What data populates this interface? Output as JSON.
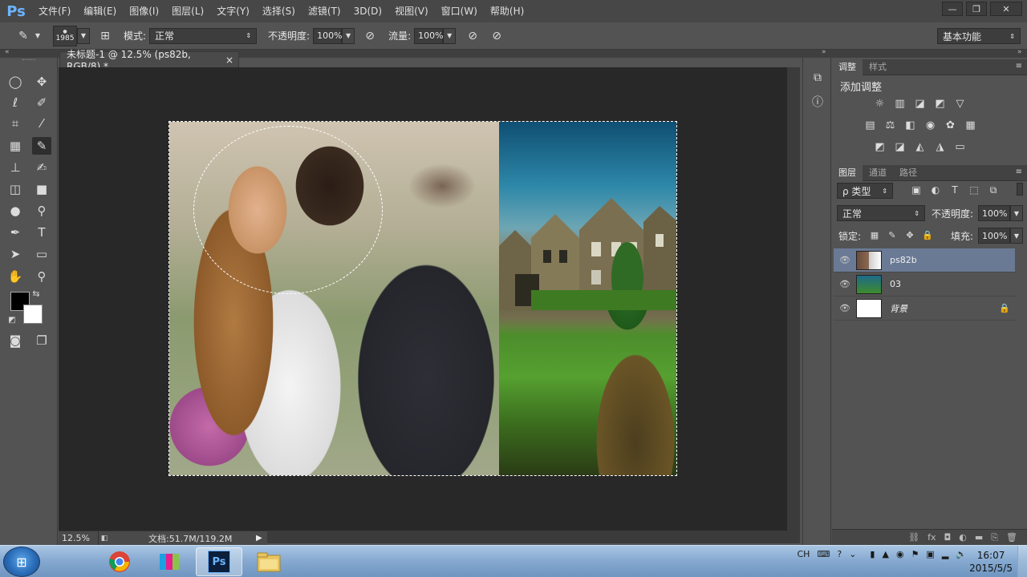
{
  "app": {
    "logo": "Ps"
  },
  "menu": [
    "文件(F)",
    "编辑(E)",
    "图像(I)",
    "图层(L)",
    "文字(Y)",
    "选择(S)",
    "滤镜(T)",
    "3D(D)",
    "视图(V)",
    "窗口(W)",
    "帮助(H)"
  ],
  "window_controls": {
    "minimize": "—",
    "restore": "❐",
    "close": "✕"
  },
  "options": {
    "brush_size": "1985",
    "mode_label": "模式:",
    "mode_value": "正常",
    "opacity_label": "不透明度:",
    "opacity_value": "100%",
    "flow_label": "流量:",
    "flow_value": "100%",
    "workspace": "基本功能"
  },
  "document": {
    "tab_title": "未标题-1 @ 12.5% (ps82b, RGB/8) *",
    "tab_close": "×"
  },
  "status": {
    "zoom": "12.5%",
    "doc_info": "文档:51.7M/119.2M"
  },
  "panels": {
    "adjust_tabs": [
      "调整",
      "样式"
    ],
    "adjust_title": "添加调整",
    "layers_tabs": [
      "图层",
      "通道",
      "路径"
    ],
    "kind_filter": "ρ 类型",
    "blend_mode": "正常",
    "opacity_label": "不透明度:",
    "opacity_value": "100%",
    "lock_label": "锁定:",
    "fill_label": "填充:",
    "fill_value": "100%",
    "layers": [
      {
        "name": "ps82b",
        "selected": true
      },
      {
        "name": "03",
        "selected": false
      },
      {
        "name": "背景",
        "selected": false,
        "locked": true
      }
    ]
  },
  "taskbar": {
    "tray_lang": "CH",
    "time": "16:07",
    "date": "2015/5/5"
  },
  "colors": {
    "accent": "#6a7a95",
    "ps_blue": "#6cb4ff"
  }
}
